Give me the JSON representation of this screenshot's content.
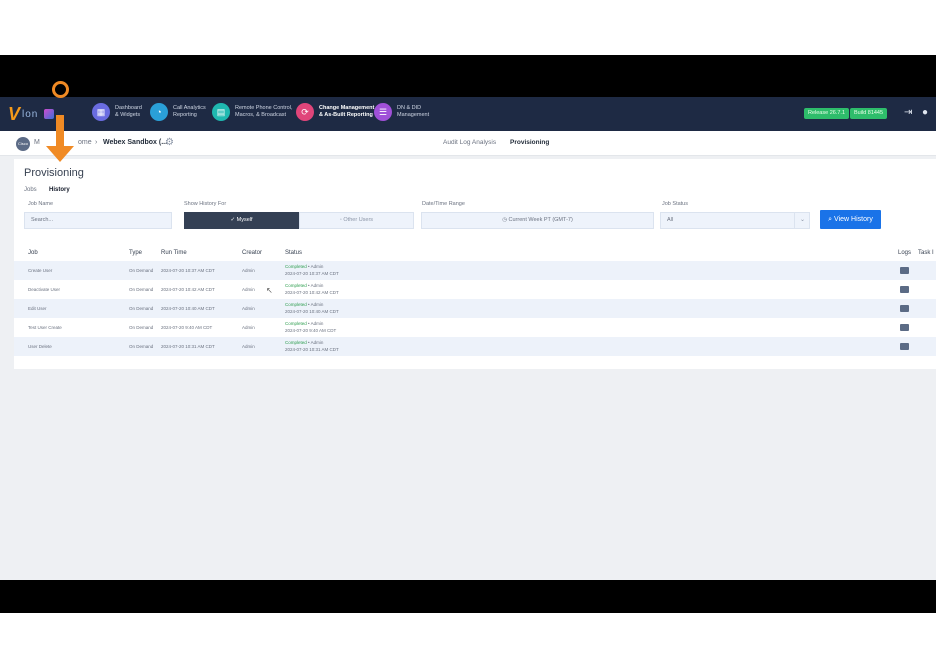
{
  "topnav": {
    "logo_text": "lon",
    "items": [
      {
        "label": "Dashboard\n& Widgets",
        "color": "#6a6ce0",
        "bold": false
      },
      {
        "label": "Call Analytics\nReporting",
        "color": "#2aa0d8",
        "bold": false
      },
      {
        "label": "Remote Phone Control,\nMacros, & Broadcast",
        "color": "#1fb8b0",
        "bold": false
      },
      {
        "label": "Change Management\n& As-Built Reporting",
        "color": "#e0457a",
        "bold": true
      },
      {
        "label": "DN & DID\nManagement",
        "color": "#a050d8",
        "bold": false
      }
    ],
    "release": "Release 26.7.1",
    "build": "Build 81445"
  },
  "breadcrumb": {
    "avatar": "Cisco",
    "part1": "M",
    "part2": "ome",
    "separator": "›",
    "current": "Webex Sandbox (..."
  },
  "top_tabs": {
    "audit": "Audit Log Analysis",
    "provisioning": "Provisioning"
  },
  "page": {
    "title": "Provisioning",
    "tab_jobs": "Jobs",
    "tab_history": "History"
  },
  "filters": {
    "job_name_label": "Job Name",
    "job_name_placeholder": "Search...",
    "show_history_label": "Show History For",
    "myself": "Myself",
    "other_users": "Other Users",
    "date_label": "Date/Time Range",
    "date_value": "Current Week PT (GMT-7)",
    "status_label": "Job Status",
    "status_value": "All",
    "view_button": "View History"
  },
  "table": {
    "headers": {
      "job": "Job",
      "type": "Type",
      "run_time": "Run Time",
      "creator": "Creator",
      "status": "Status",
      "logs": "Logs",
      "task": "Task I"
    },
    "rows": [
      {
        "job": "Create User",
        "type": "On Demand",
        "run_time": "2024-07-20 10:37 AM CDT",
        "creator": "Admin",
        "status": "Completed",
        "by": "• Admin",
        "status_time": "2024-07-20 10:37 AM CDT"
      },
      {
        "job": "Deactivate User",
        "type": "On Demand",
        "run_time": "2024-07-20 10:42 AM CDT",
        "creator": "Admin",
        "status": "Completed",
        "by": "• Admin",
        "status_time": "2024-07-20 10:42 AM CDT"
      },
      {
        "job": "Edit User",
        "type": "On Demand",
        "run_time": "2024-07-20 10:40 AM CDT",
        "creator": "Admin",
        "status": "Completed",
        "by": "• Admin",
        "status_time": "2024-07-20 10:40 AM CDT"
      },
      {
        "job": "Test User Create",
        "type": "On Demand",
        "run_time": "2024-07-20 9:40 AM CDT",
        "creator": "Admin",
        "status": "Completed",
        "by": "• Admin",
        "status_time": "2024-07-20 9:40 AM CDT"
      },
      {
        "job": "User Delete",
        "type": "On Demand",
        "run_time": "2024-07-20 10:31 AM CDT",
        "creator": "Admin",
        "status": "Completed",
        "by": "• Admin",
        "status_time": "2024-07-20 10:31 AM CDT"
      }
    ]
  },
  "colors": {
    "accent": "#1a73e8",
    "annotation": "#f08a24",
    "nav_bg": "#1e2a44"
  }
}
